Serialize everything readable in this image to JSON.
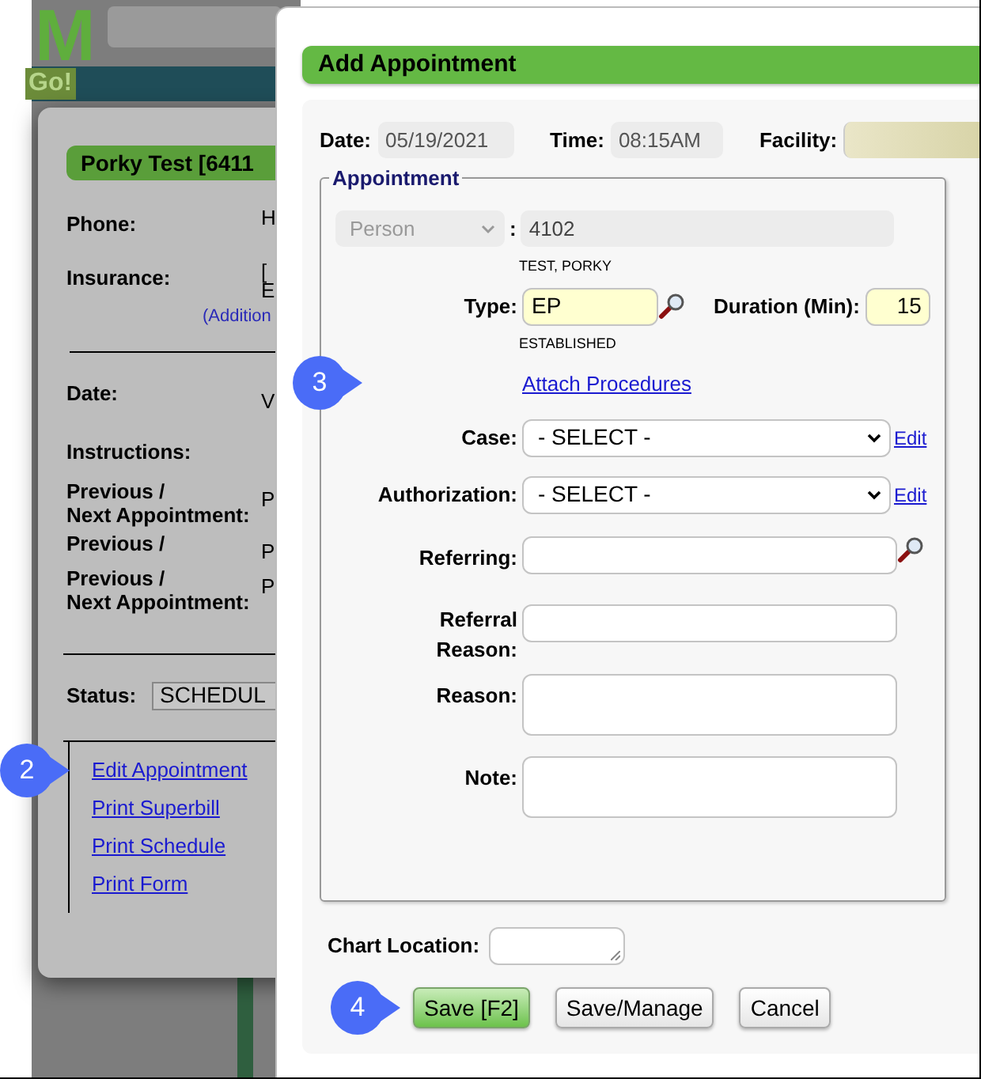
{
  "background": {
    "logo_letter": "M",
    "logo_tagline": "Go!"
  },
  "patient_popup": {
    "title": "Porky Test [6411",
    "contact_rows": [
      {
        "label": "Phone:",
        "value": "H"
      },
      {
        "label": "Insurance:",
        "value": "[",
        "value_2": "E"
      }
    ],
    "additional_link": "(Addition",
    "appointment_rows": [
      {
        "label": "Date:",
        "value": "V"
      },
      {
        "label": "Instructions:"
      },
      {
        "label": "Previous /",
        "label_2": "Next Appointment:",
        "value": "P"
      },
      {
        "label": "Previous /",
        "value": "P"
      },
      {
        "label": "Previous /",
        "label_2": "Next Appointment:",
        "value": "P"
      }
    ],
    "status": {
      "label": "Status:",
      "value": "SCHEDUL"
    },
    "links": [
      {
        "label": "Edit Appointment",
        "callout": "2"
      },
      {
        "label": "Print Superbill"
      },
      {
        "label": "Print Schedule"
      },
      {
        "label": "Print Form"
      }
    ]
  },
  "dialog": {
    "title": "Add Appointment",
    "date": {
      "label": "Date:",
      "value": "05/19/2021"
    },
    "time": {
      "label": "Time:",
      "value": "08:15AM"
    },
    "facility": {
      "label": "Facility:"
    },
    "appointment": {
      "legend": "Appointment",
      "callout": "3",
      "person_select": {
        "value": "Person",
        "disabled": true
      },
      "person_separator": ":",
      "person_id": "4102",
      "person_name": "TEST, PORKY",
      "type": {
        "label": "Type:",
        "value": "EP",
        "description": "ESTABLISHED"
      },
      "duration": {
        "label": "Duration (Min):",
        "value": "15"
      },
      "attach_link": "Attach Procedures",
      "case": {
        "label": "Case:",
        "value": "- SELECT -",
        "edit": "Edit"
      },
      "authorization": {
        "label": "Authorization:",
        "value": "- SELECT -",
        "edit": "Edit"
      },
      "referring": {
        "label": "Referring:"
      },
      "referral_reason": {
        "label": "Referral",
        "label_2": "Reason:"
      },
      "reason": {
        "label": "Reason:"
      },
      "note": {
        "label": "Note:"
      }
    },
    "chart_location": {
      "label": "Chart Location:"
    },
    "buttons": [
      {
        "label": "Save [F2]",
        "primary": true,
        "callout": "4"
      },
      {
        "label": "Save/Manage",
        "primary": false
      },
      {
        "label": "Cancel",
        "primary": false
      }
    ]
  }
}
